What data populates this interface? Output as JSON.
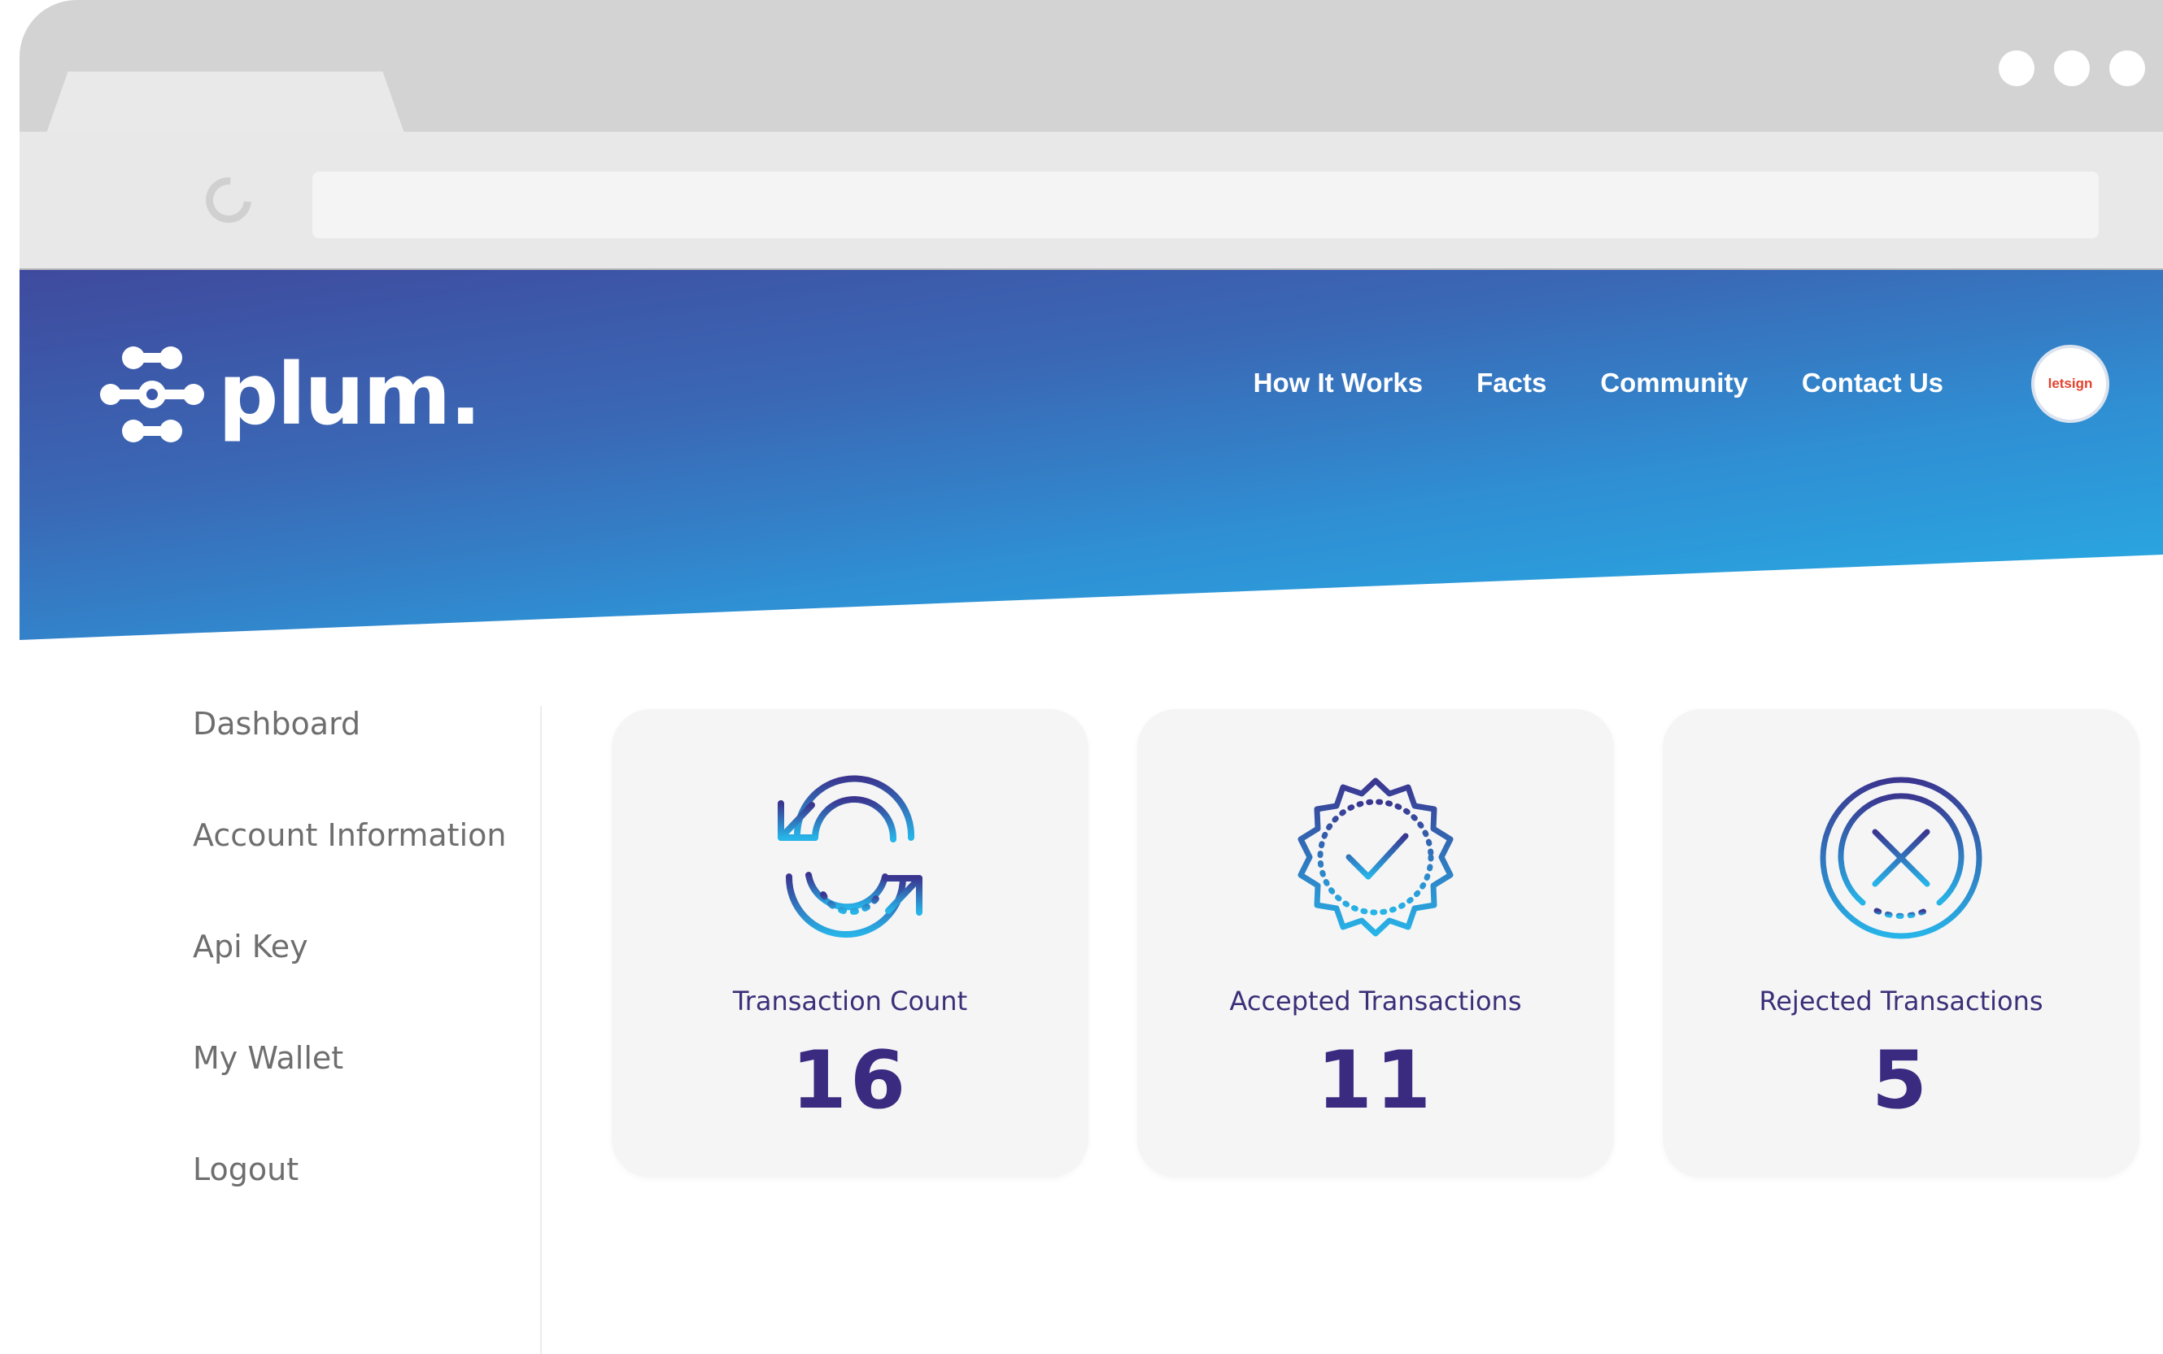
{
  "brand": {
    "name": "plum.",
    "partner_badge": "letsign"
  },
  "nav": {
    "items": [
      "How It Works",
      "Facts",
      "Community",
      "Contact Us"
    ]
  },
  "sidebar": {
    "items": [
      {
        "label": "Dashboard"
      },
      {
        "label": "Account Information"
      },
      {
        "label": "Api Key"
      },
      {
        "label": "My Wallet"
      },
      {
        "label": "Logout"
      }
    ]
  },
  "stats": [
    {
      "label": "Transaction Count",
      "value": "16",
      "icon": "refresh-icon"
    },
    {
      "label": "Accepted Transactions",
      "value": "11",
      "icon": "verified-badge-icon"
    },
    {
      "label": "Rejected Transactions",
      "value": "5",
      "icon": "reject-x-icon"
    }
  ],
  "colors": {
    "accent": "#3a2a80",
    "gradient_start": "#3f4a9e",
    "gradient_end": "#27b0e6",
    "icon_gradient_start": "#3a3690",
    "icon_gradient_end": "#27b4e8"
  }
}
